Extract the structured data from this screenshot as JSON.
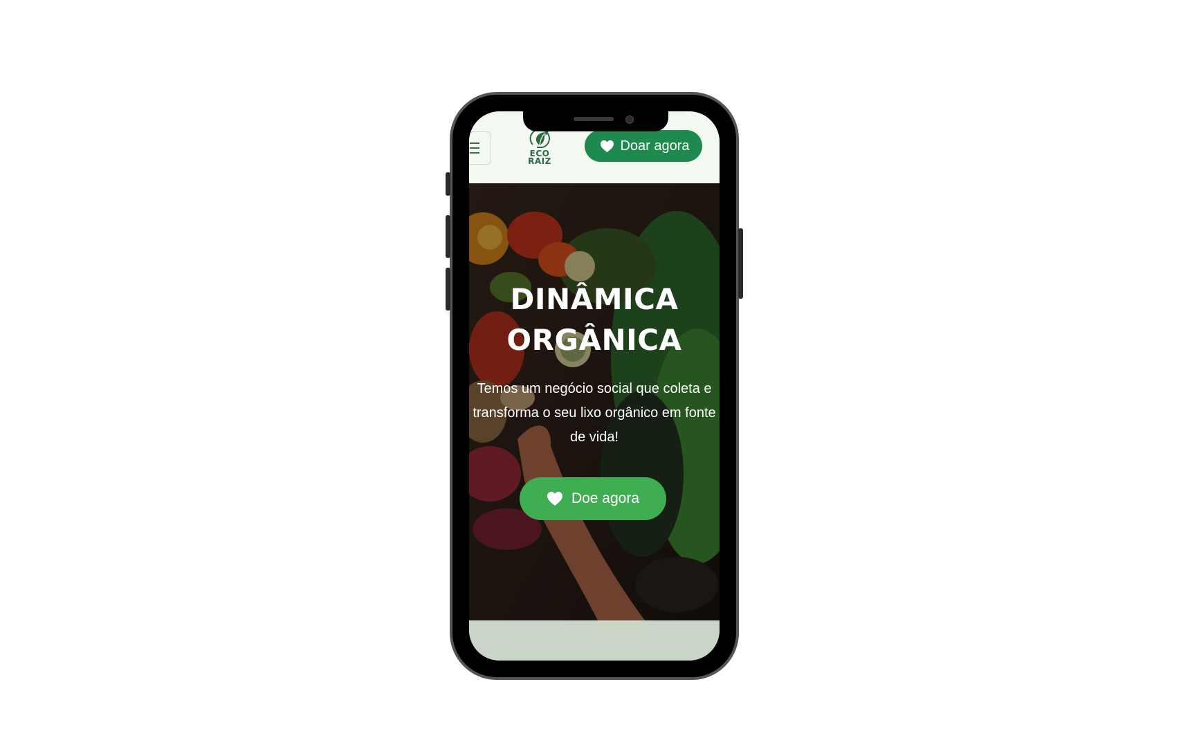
{
  "header": {
    "logo_line1": "ECO",
    "logo_line2": "RAIZ",
    "donate_label": "Doar agora"
  },
  "hero": {
    "title_line1": "DINÂMICA",
    "title_line2": "ORGÂNICA",
    "description": "Temos um negócio social que coleta e transforma o seu lixo orgânico em fonte de vida!",
    "donate_label": "Doe agora"
  },
  "icons": {
    "menu": "hamburger-icon",
    "logo": "leaf-recycle-icon",
    "donate": "heart-icon"
  },
  "colors": {
    "header_bg": "#f3f8f1",
    "header_button": "#1f8a50",
    "hero_button": "#3fae52",
    "logo_green": "#2e6a40",
    "footer_strip": "#c9d5c6"
  }
}
